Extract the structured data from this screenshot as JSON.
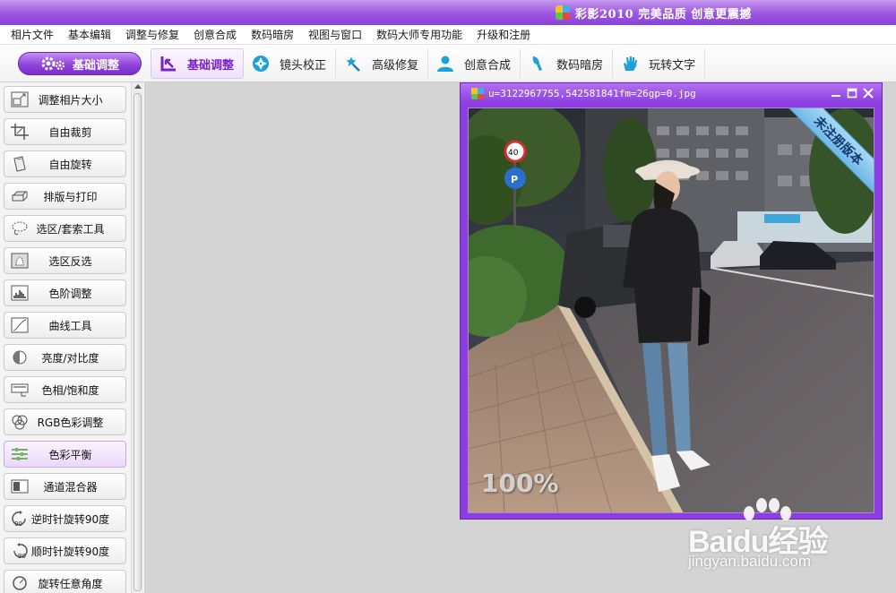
{
  "app": {
    "title": "彩影2010  完美品质  创意更震撼"
  },
  "menu": [
    "相片文件",
    "基本编辑",
    "调整与修复",
    "创意合成",
    "数码暗房",
    "视图与窗口",
    "数码大师专用功能",
    "升级和注册"
  ],
  "toolbar": {
    "main_button": "基础调整",
    "tabs": [
      {
        "label": "基础调整",
        "icon": "crop-arrow-icon",
        "active": true
      },
      {
        "label": "镜头校正",
        "icon": "aperture-icon",
        "active": false
      },
      {
        "label": "高级修复",
        "icon": "magic-wand-icon",
        "active": false
      },
      {
        "label": "创意合成",
        "icon": "person-icon",
        "active": false
      },
      {
        "label": "数码暗房",
        "icon": "dropper-icon",
        "active": false
      },
      {
        "label": "玩转文字",
        "icon": "hand-icon",
        "active": false
      }
    ]
  },
  "sidebar": {
    "items": [
      {
        "label": "调整相片大小",
        "icon": "resize-icon"
      },
      {
        "label": "自由裁剪",
        "icon": "crop-icon"
      },
      {
        "label": "自由旋转",
        "icon": "rotate-page-icon"
      },
      {
        "label": "排版与打印",
        "icon": "printer-icon"
      },
      {
        "label": "选区/套索工具",
        "icon": "lasso-icon"
      },
      {
        "label": "选区反选",
        "icon": "invert-selection-icon"
      },
      {
        "label": "色阶调整",
        "icon": "histogram-icon"
      },
      {
        "label": "曲线工具",
        "icon": "curve-icon"
      },
      {
        "label": "亮度/对比度",
        "icon": "contrast-icon"
      },
      {
        "label": "色相/饱和度",
        "icon": "hue-icon"
      },
      {
        "label": "RGB色彩调整",
        "icon": "rgb-circles-icon"
      },
      {
        "label": "色彩平衡",
        "icon": "sliders-icon",
        "active": true
      },
      {
        "label": "通道混合器",
        "icon": "channel-icon"
      },
      {
        "label": "逆时针旋转90度",
        "icon": "rotate-ccw-90-icon"
      },
      {
        "label": "顺时针旋转90度",
        "icon": "rotate-cw-90-icon"
      },
      {
        "label": "旋转任意角度",
        "icon": "rotate-any-icon"
      }
    ]
  },
  "image_window": {
    "filename": "u=3122967755,542581841fm=26gp=0.jpg",
    "zoom": "100%",
    "ribbon": "未注册版本"
  },
  "watermark": {
    "brand": "Baidu经验",
    "url": "jingyan.baidu.com"
  },
  "colors": {
    "accent": "#8c3ee0",
    "title_bar": "#9b55e0",
    "active_tab_text": "#7b21c9"
  }
}
